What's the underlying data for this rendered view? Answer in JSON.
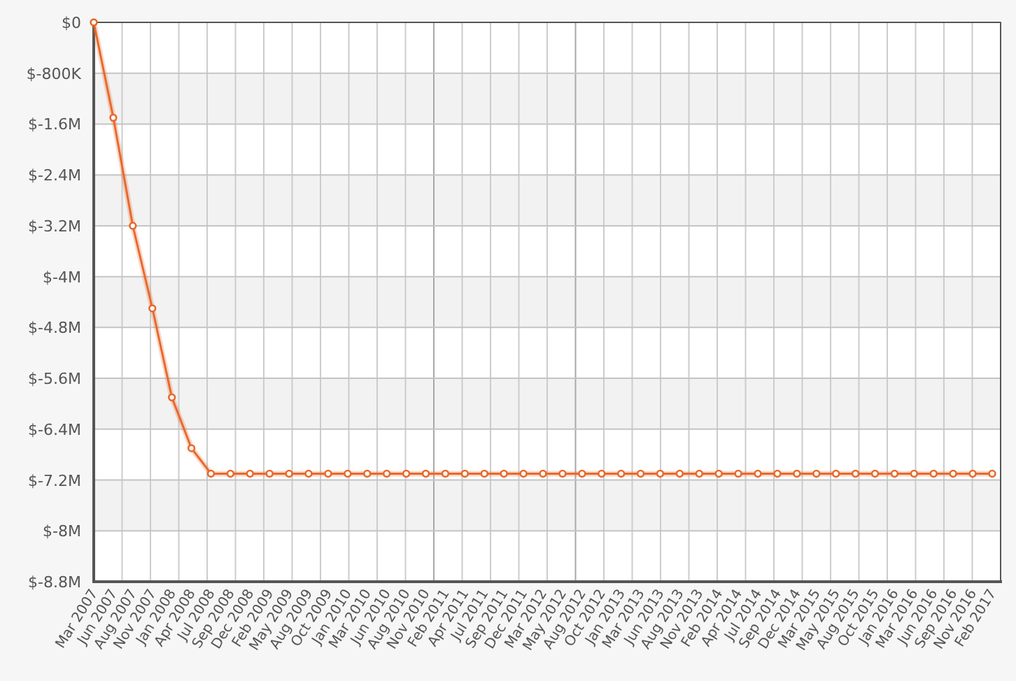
{
  "chart_data": {
    "type": "line",
    "grid": true,
    "ylim": [
      -8800000,
      0
    ],
    "yticks": [
      {
        "value": 0,
        "label": "$0"
      },
      {
        "value": -800000,
        "label": "$-800K"
      },
      {
        "value": -1600000,
        "label": "$-1.6M"
      },
      {
        "value": -2400000,
        "label": "$-2.4M"
      },
      {
        "value": -3200000,
        "label": "$-3.2M"
      },
      {
        "value": -4000000,
        "label": "$-4M"
      },
      {
        "value": -4800000,
        "label": "$-4.8M"
      },
      {
        "value": -5600000,
        "label": "$-5.6M"
      },
      {
        "value": -6400000,
        "label": "$-6.4M"
      },
      {
        "value": -7200000,
        "label": "$-7.2M"
      },
      {
        "value": -8000000,
        "label": "$-8M"
      },
      {
        "value": -8800000,
        "label": "$-8.8M"
      }
    ],
    "categories": [
      "Mar 2007",
      "Jun 2007",
      "Aug 2007",
      "Nov 2007",
      "Jan 2008",
      "Apr 2008",
      "Jul 2008",
      "Sep 2008",
      "Dec 2008",
      "Feb 2009",
      "May 2009",
      "Aug 2009",
      "Oct 2009",
      "Jan 2010",
      "Mar 2010",
      "Jun 2010",
      "Aug 2010",
      "Nov 2010",
      "Feb 2011",
      "Apr 2011",
      "Jul 2011",
      "Sep 2011",
      "Dec 2011",
      "Mar 2012",
      "May 2012",
      "Aug 2012",
      "Oct 2012",
      "Jan 2013",
      "Mar 2013",
      "Jun 2013",
      "Aug 2013",
      "Nov 2013",
      "Feb 2014",
      "Apr 2014",
      "Jul 2014",
      "Sep 2014",
      "Dec 2014",
      "Mar 2015",
      "May 2015",
      "Aug 2015",
      "Oct 2015",
      "Jan 2016",
      "Mar 2016",
      "Jun 2016",
      "Sep 2016",
      "Nov 2016",
      "Feb 2017"
    ],
    "series": [
      {
        "color": "#e8692c",
        "marker": "circle",
        "values": [
          0,
          -1500000,
          -3200000,
          -4500000,
          -5900000,
          -6700000,
          -7100000,
          -7100000,
          -7100000,
          -7100000,
          -7100000,
          -7100000,
          -7100000,
          -7100000,
          -7100000,
          -7100000,
          -7100000,
          -7100000,
          -7100000,
          -7100000,
          -7100000,
          -7100000,
          -7100000,
          -7100000,
          -7100000,
          -7100000,
          -7100000,
          -7100000,
          -7100000,
          -7100000,
          -7100000,
          -7100000,
          -7100000,
          -7100000,
          -7100000,
          -7100000,
          -7100000,
          -7100000,
          -7100000,
          -7100000,
          -7100000,
          -7100000,
          -7100000,
          -7100000,
          -7100000,
          -7100000,
          -7100000
        ]
      }
    ]
  }
}
